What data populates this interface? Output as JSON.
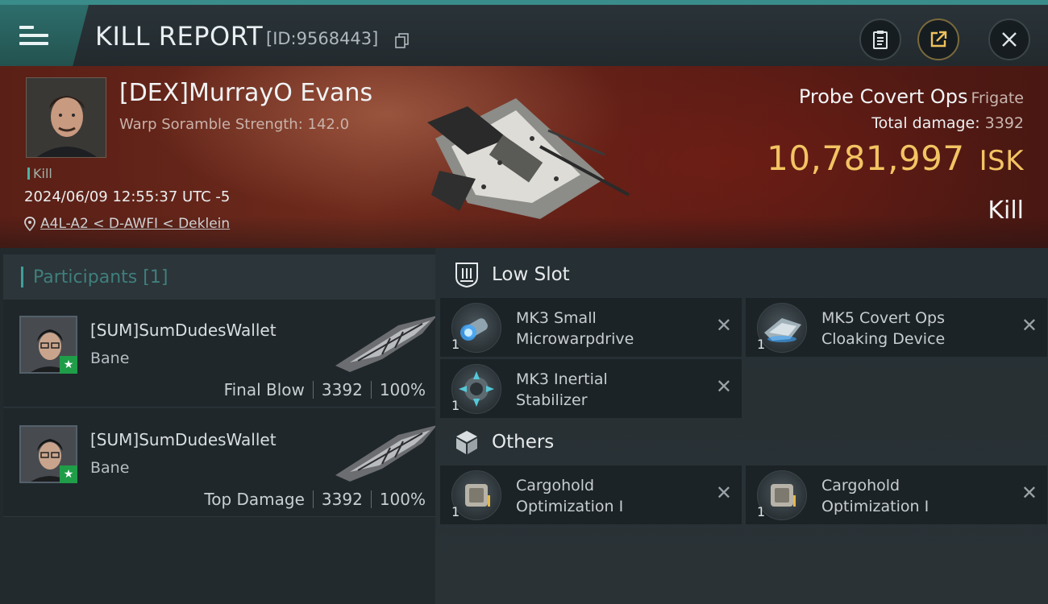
{
  "header": {
    "title": "KILL REPORT",
    "report_id": "[ID:9568443]"
  },
  "victim": {
    "name": "[DEX]MurrayO Evans",
    "stat_line": "Warp Soramble Strength: 142.0",
    "tag": "Kill",
    "timestamp": "2024/06/09 12:55:37 UTC -5",
    "location": "A4L-A2 < D-AWFI < Deklein",
    "ship_name": "Probe Covert Ops",
    "ship_class": "Frigate",
    "total_damage_label": "Total damage:",
    "total_damage": "3392",
    "isk_value": "10,781,997",
    "isk_unit": "ISK",
    "kill_type": "Kill"
  },
  "participants": {
    "label": "Participants",
    "count": "[1]",
    "rows": [
      {
        "name": "[SUM]SumDudesWallet",
        "ship": "Bane",
        "role": "Final Blow",
        "damage": "3392",
        "percent": "100%"
      },
      {
        "name": "[SUM]SumDudesWallet",
        "ship": "Bane",
        "role": "Top Damage",
        "damage": "3392",
        "percent": "100%"
      }
    ]
  },
  "fitting": {
    "low_slot_label": "Low Slot",
    "low_slot_items": [
      {
        "line1": "MK3 Small",
        "line2": "Microwarpdrive",
        "qty": "1",
        "icon": "microwarpdrive-icon"
      },
      {
        "line1": "MK5 Covert Ops",
        "line2": "Cloaking Device",
        "qty": "1",
        "icon": "cloaking-device-icon"
      },
      {
        "line1": "MK3 Inertial",
        "line2": "Stabilizer",
        "qty": "1",
        "icon": "inertial-stabilizer-icon"
      }
    ],
    "others_label": "Others",
    "others_items": [
      {
        "line1": "Cargohold",
        "line2": "Optimization I",
        "qty": "1",
        "icon": "cargohold-icon"
      },
      {
        "line1": "Cargohold",
        "line2": "Optimization I",
        "qty": "1",
        "icon": "cargohold-icon"
      }
    ],
    "remove_glyph": "✕"
  },
  "colors": {
    "accent_teal": "#3f9f99",
    "isk_gold": "#f3c463",
    "banner_red": "#6e2a1c",
    "star_green": "#1f9d48"
  }
}
